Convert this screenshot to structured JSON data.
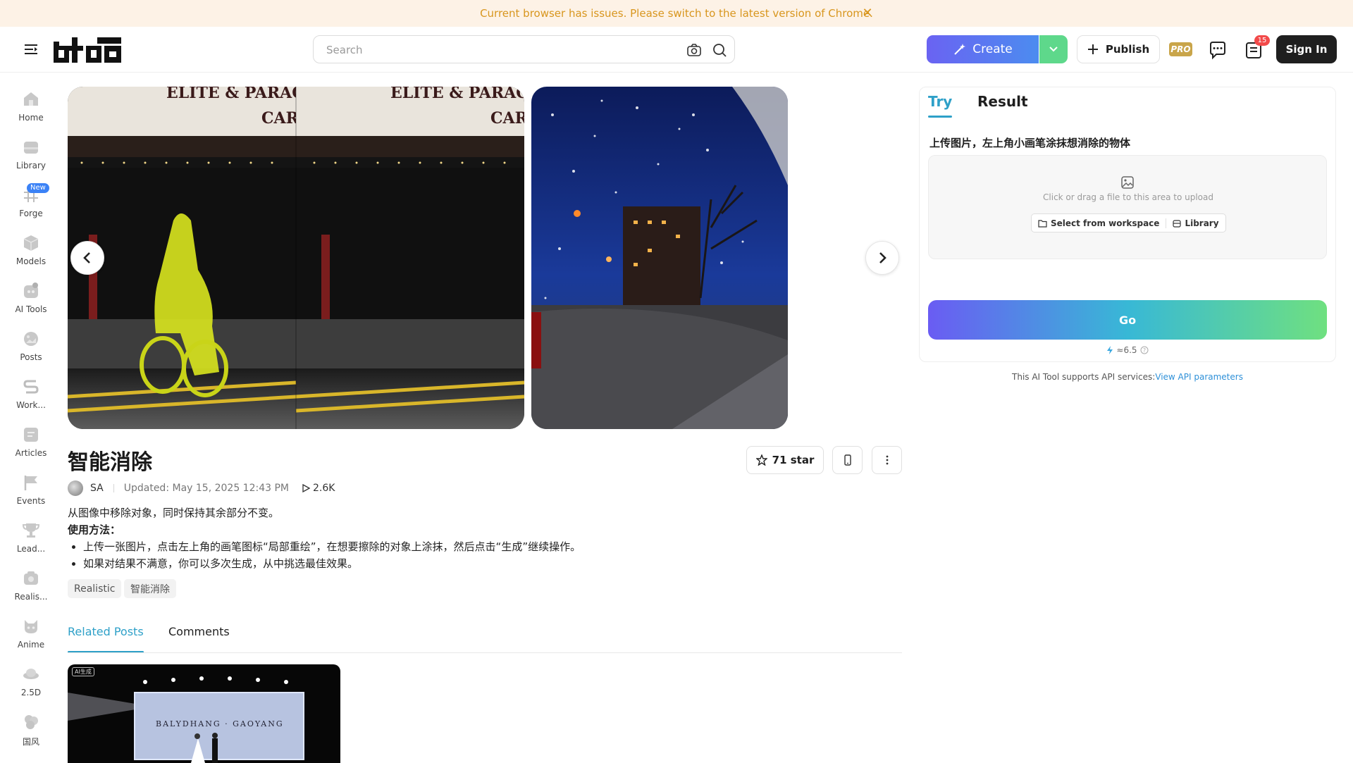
{
  "banner": {
    "text": "Current browser has issues. Please switch to the latest version of Chrome."
  },
  "header": {
    "search_placeholder": "Search",
    "create_label": "Create",
    "publish_label": "Publish",
    "pro_label": "PRO",
    "notification_count": "15",
    "signin_label": "Sign In"
  },
  "sidebar": {
    "items": [
      {
        "label": "Home",
        "icon": "home-icon"
      },
      {
        "label": "Library",
        "icon": "library-icon"
      },
      {
        "label": "Forge",
        "icon": "forge-icon",
        "badge": "New"
      },
      {
        "label": "Models",
        "icon": "models-icon"
      },
      {
        "label": "AI Tools",
        "icon": "ai-tools-icon"
      },
      {
        "label": "Posts",
        "icon": "posts-icon"
      },
      {
        "label": "Work...",
        "icon": "workflow-icon"
      },
      {
        "label": "Articles",
        "icon": "articles-icon"
      },
      {
        "label": "Events",
        "icon": "events-icon"
      },
      {
        "label": "Lead...",
        "icon": "leaderboard-icon"
      },
      {
        "label": "Realis...",
        "icon": "realistic-icon"
      },
      {
        "label": "Anime",
        "icon": "anime-icon"
      },
      {
        "label": "2.5D",
        "icon": "2-5d-icon"
      },
      {
        "label": "国风",
        "icon": "guofeng-icon"
      }
    ]
  },
  "tool": {
    "title": "智能消除",
    "star_label": "71 star",
    "author": "SA",
    "updated": "Updated: May 15, 2025 12:43 PM",
    "views": "2.6K",
    "description": "从图像中移除对象，同时保持其余部分不变。",
    "usage_heading": "使用方法：",
    "usage_steps": [
      "上传一张图片，点击左上角的画笔图标“局部重绘”，在想要擦除的对象上涂抹，然后点击“生成”继续操作。",
      "如果对结果不满意，你可以多次生成，从中挑选最佳效果。"
    ],
    "tags": [
      "Realistic",
      "智能消除"
    ]
  },
  "content_tabs": {
    "related": "Related Posts",
    "comments": "Comments"
  },
  "related_post": {
    "ai_label": "AI生成"
  },
  "panel": {
    "tab_try": "Try",
    "tab_result": "Result",
    "instruction": "上传图片，左上角小画笔涂抹想消除的物体",
    "upload_text": "Click or drag a file to this area to upload",
    "select_workspace": "Select from workspace",
    "library": "Library",
    "go_label": "Go",
    "cost": "≈6.5",
    "api_text": "This AI Tool supports API services:",
    "api_link": "View API parameters"
  },
  "colors": {
    "accent": "#2ea0c8",
    "banner_text": "#d8961e",
    "badge_red": "#f24a4a"
  }
}
